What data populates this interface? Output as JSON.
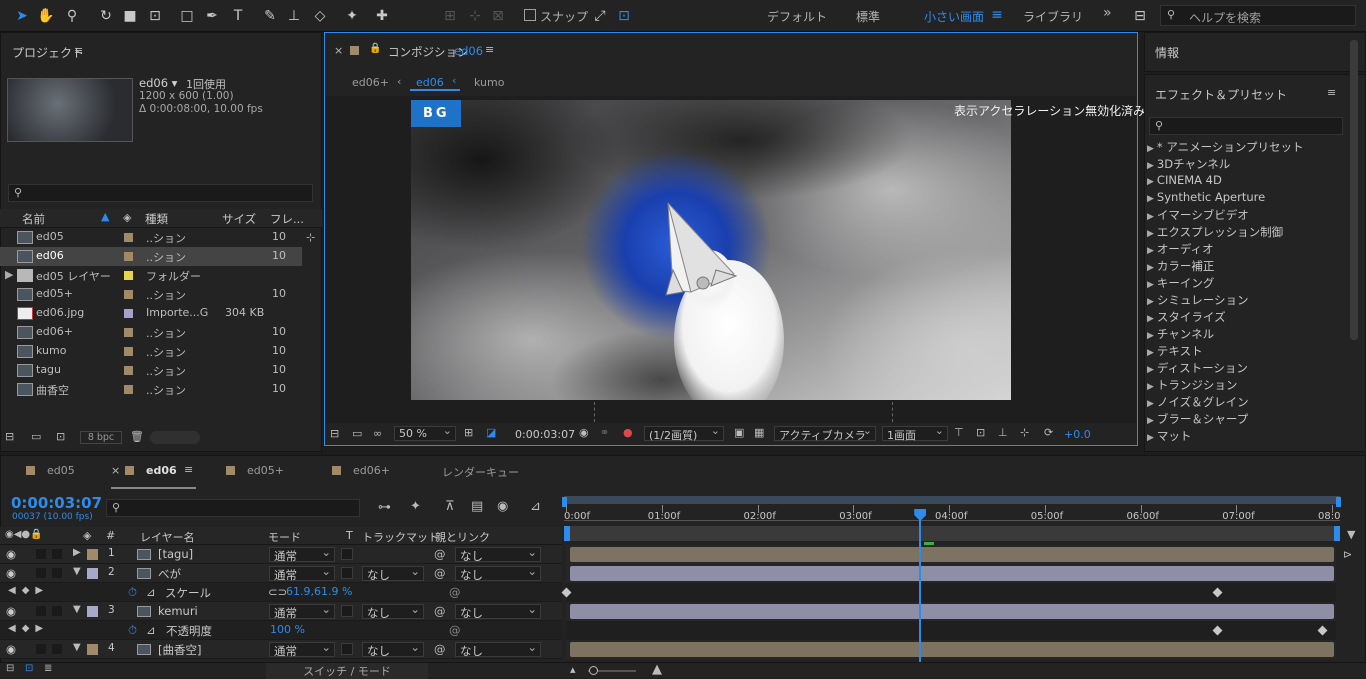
{
  "toolbar": {
    "snap_label": "スナップ",
    "workspaces": [
      "デフォルト",
      "標準",
      "小さい画面",
      "ライブラリ"
    ],
    "active_workspace": "小さい画面",
    "help_placeholder": "ヘルプを検索",
    "overflow": "»"
  },
  "project": {
    "title": "プロジェクト",
    "item_name": "ed06 ▾",
    "item_usage": "1回使用",
    "item_size": "1200 x 600 (1.00)",
    "item_duration": "Δ 0:00:08:00, 10.00 fps",
    "columns": [
      "名前",
      "種類",
      "サイズ",
      "フレ..."
    ],
    "items": [
      {
        "name": "ed05",
        "type": "..ション",
        "size": "",
        "frames": "10",
        "color": "#a08a6a",
        "kind": "comp"
      },
      {
        "name": "ed06",
        "type": "..ション",
        "size": "",
        "frames": "10",
        "color": "#a08a6a",
        "kind": "comp"
      },
      {
        "name": "ed05 レイヤー",
        "type": "フォルダー",
        "size": "",
        "frames": "",
        "color": "#e8d44d",
        "kind": "folder"
      },
      {
        "name": "ed05+",
        "type": "..ション",
        "size": "",
        "frames": "10",
        "color": "#a08a6a",
        "kind": "comp"
      },
      {
        "name": "ed06.jpg",
        "type": "Importe...G",
        "size": "304 KB",
        "frames": "",
        "color": "#a8a0c8",
        "kind": "file"
      },
      {
        "name": "ed06+",
        "type": "..ション",
        "size": "",
        "frames": "10",
        "color": "#a08a6a",
        "kind": "comp"
      },
      {
        "name": "kumo",
        "type": "..ション",
        "size": "",
        "frames": "10",
        "color": "#a08a6a",
        "kind": "comp"
      },
      {
        "name": "tagu",
        "type": "..ション",
        "size": "",
        "frames": "10",
        "color": "#a08a6a",
        "kind": "comp"
      },
      {
        "name": "曲香空",
        "type": "..ション",
        "size": "",
        "frames": "10",
        "color": "#a08a6a",
        "kind": "comp"
      }
    ],
    "bpc": "8 bpc"
  },
  "composition": {
    "tab_label": "コンポジション",
    "comp_name": "ed06",
    "breadcrumbs": [
      "ed06+",
      "ed06",
      "kumo"
    ],
    "bg_label": "BG",
    "accel_notice": "表示アクセラレーション無効化済み",
    "zoom": "50 %",
    "timecode": "0:00:03:07",
    "quality": "(1/2画質)",
    "camera": "アクティブカメラ",
    "views": "1画面",
    "exposure": "+0.0"
  },
  "info_panel": {
    "title": "情報"
  },
  "effects": {
    "title": "エフェクト＆プリセット",
    "items": [
      "* アニメーションプリセット",
      "3Dチャンネル",
      "CINEMA 4D",
      "Synthetic Aperture",
      "イマーシブビデオ",
      "エクスプレッション制御",
      "オーディオ",
      "カラー補正",
      "キーイング",
      "シミュレーション",
      "スタイライズ",
      "チャンネル",
      "テキスト",
      "ディストーション",
      "トランジション",
      "ノイズ＆グレイン",
      "ブラー＆シャープ",
      "マット"
    ]
  },
  "timeline": {
    "tabs": [
      "ed05",
      "ed06",
      "ed05+",
      "ed06+",
      "レンダーキュー"
    ],
    "active_tab": "ed06",
    "timecode": "0:00:03:07",
    "frame_info": "00037 (10.00 fps)",
    "columns": {
      "layer_name": "レイヤー名",
      "mode": "モード",
      "t": "T",
      "track_matte": "トラックマット",
      "parent": "親とリンク",
      "hash": "#"
    },
    "time_ticks": [
      "0:00f",
      "01:00f",
      "02:00f",
      "03:00f",
      "04:00f",
      "05:00f",
      "06:00f",
      "07:00f",
      "08:0"
    ],
    "playhead_seconds": 3.7,
    "duration_seconds": 8,
    "layers": [
      {
        "num": "1",
        "name": "[tagu]",
        "mode": "通常",
        "matte": "",
        "parent": "なし",
        "color": "#a08a6a"
      },
      {
        "num": "2",
        "name": "べが",
        "mode": "通常",
        "matte": "なし",
        "parent": "なし",
        "color": "#a8a8c8"
      },
      {
        "num": "3",
        "name": "kemuri",
        "mode": "通常",
        "matte": "なし",
        "parent": "なし",
        "color": "#a8a8c8"
      },
      {
        "num": "4",
        "name": "[曲香空]",
        "mode": "通常",
        "matte": "なし",
        "parent": "なし",
        "color": "#a08a6a"
      }
    ],
    "props": [
      {
        "name": "スケール",
        "value": "61.9,61.9 %"
      },
      {
        "name": "不透明度",
        "value": "100 %"
      }
    ],
    "switch_mode": "スイッチ / モード"
  }
}
